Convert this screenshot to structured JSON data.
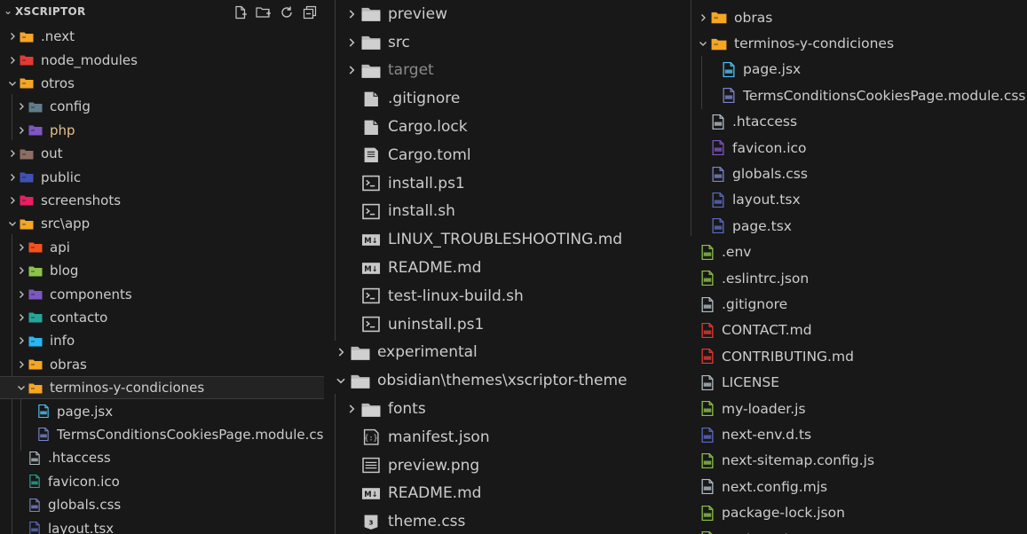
{
  "panel1": {
    "title": "XSCRIPTOR",
    "header_icons": [
      "new-file-icon",
      "new-folder-icon",
      "refresh-icon",
      "collapse-all-icon"
    ],
    "items": [
      {
        "label": ".next",
        "kind": "folder",
        "color": "#f5a623",
        "expanded": false
      },
      {
        "label": "node_modules",
        "kind": "folder",
        "color": "#e53935",
        "expanded": false
      },
      {
        "label": "otros",
        "kind": "folder",
        "color": "#f5a623",
        "expanded": true
      },
      {
        "label": "config",
        "kind": "folder",
        "color": "#607d8b",
        "expanded": false
      },
      {
        "label": "php",
        "kind": "folder",
        "color": "#7e57c2",
        "expanded": false
      },
      {
        "label": "out",
        "kind": "folder",
        "color": "#8d6e63",
        "expanded": false
      },
      {
        "label": "public",
        "kind": "folder",
        "color": "#3f51b5",
        "expanded": false
      },
      {
        "label": "screenshots",
        "kind": "folder",
        "color": "#e91e63",
        "expanded": false
      },
      {
        "label": "src\\app",
        "kind": "folder",
        "color": "#f5a623",
        "expanded": true
      },
      {
        "label": "api",
        "kind": "folder",
        "color": "#f4511e",
        "expanded": false
      },
      {
        "label": "blog",
        "kind": "folder",
        "color": "#8bc34a",
        "expanded": false
      },
      {
        "label": "components",
        "kind": "folder",
        "color": "#7e57c2",
        "expanded": false
      },
      {
        "label": "contacto",
        "kind": "folder",
        "color": "#26a69a",
        "expanded": false
      },
      {
        "label": "info",
        "kind": "folder",
        "color": "#29b6f6",
        "expanded": false
      },
      {
        "label": "obras",
        "kind": "folder",
        "color": "#f5a623",
        "expanded": false
      },
      {
        "label": "terminos-y-condiciones",
        "kind": "folder",
        "color": "#f5a623",
        "expanded": true
      },
      {
        "label": "page.jsx",
        "kind": "file",
        "color": "#4fc3f7"
      },
      {
        "label": "TermsConditionsCookiesPage.module.css",
        "kind": "file",
        "color": "#7986cb"
      },
      {
        "label": ".htaccess",
        "kind": "file",
        "color": "#b0bec5"
      },
      {
        "label": "favicon.ico",
        "kind": "file",
        "color": "#26a69a"
      },
      {
        "label": "globals.css",
        "kind": "file",
        "color": "#7986cb"
      },
      {
        "label": "layout.tsx",
        "kind": "file",
        "color": "#5c6bc0"
      }
    ]
  },
  "panel2": {
    "items": [
      {
        "label": "preview",
        "kind": "folder",
        "expanded": false
      },
      {
        "label": "src",
        "kind": "folder",
        "expanded": false
      },
      {
        "label": "target",
        "kind": "folder",
        "expanded": false
      },
      {
        "label": ".gitignore",
        "kind": "file"
      },
      {
        "label": "Cargo.lock",
        "kind": "file"
      },
      {
        "label": "Cargo.toml",
        "kind": "file"
      },
      {
        "label": "install.ps1",
        "kind": "file"
      },
      {
        "label": "install.sh",
        "kind": "file"
      },
      {
        "label": "LINUX_TROUBLESHOOTING.md",
        "kind": "file"
      },
      {
        "label": "README.md",
        "kind": "file"
      },
      {
        "label": "test-linux-build.sh",
        "kind": "file"
      },
      {
        "label": "uninstall.ps1",
        "kind": "file"
      },
      {
        "label": "experimental",
        "kind": "folder",
        "expanded": false
      },
      {
        "label": "obsidian\\themes\\xscriptor-theme",
        "kind": "folder",
        "expanded": true
      },
      {
        "label": "fonts",
        "kind": "folder",
        "expanded": false
      },
      {
        "label": "manifest.json",
        "kind": "file"
      },
      {
        "label": "preview.png",
        "kind": "file"
      },
      {
        "label": "README.md",
        "kind": "file"
      },
      {
        "label": "theme.css",
        "kind": "file"
      }
    ]
  },
  "panel3": {
    "items": [
      {
        "label": "obras",
        "kind": "folder",
        "color": "#f5a623",
        "expanded": false
      },
      {
        "label": "terminos-y-condiciones",
        "kind": "folder",
        "color": "#f5a623",
        "expanded": true
      },
      {
        "label": "page.jsx",
        "kind": "file",
        "color": "#4fc3f7"
      },
      {
        "label": "TermsConditionsCookiesPage.module.css",
        "kind": "file",
        "color": "#7986cb"
      },
      {
        "label": ".htaccess",
        "kind": "file",
        "color": "#b0bec5"
      },
      {
        "label": "favicon.ico",
        "kind": "file",
        "color": "#7e57c2"
      },
      {
        "label": "globals.css",
        "kind": "file",
        "color": "#7986cb"
      },
      {
        "label": "layout.tsx",
        "kind": "file",
        "color": "#5c6bc0"
      },
      {
        "label": "page.tsx",
        "kind": "file",
        "color": "#5c6bc0"
      },
      {
        "label": ".env",
        "kind": "file",
        "color": "#8bc34a"
      },
      {
        "label": ".eslintrc.json",
        "kind": "file",
        "color": "#8bc34a"
      },
      {
        "label": ".gitignore",
        "kind": "file",
        "color": "#b0bec5"
      },
      {
        "label": "CONTACT.md",
        "kind": "file",
        "color": "#e53935"
      },
      {
        "label": "CONTRIBUTING.md",
        "kind": "file",
        "color": "#e53935"
      },
      {
        "label": "LICENSE",
        "kind": "file",
        "color": "#b0bec5"
      },
      {
        "label": "my-loader.js",
        "kind": "file",
        "color": "#8bc34a"
      },
      {
        "label": "next-env.d.ts",
        "kind": "file",
        "color": "#5c6bc0"
      },
      {
        "label": "next-sitemap.config.js",
        "kind": "file",
        "color": "#8bc34a"
      },
      {
        "label": "next.config.mjs",
        "kind": "file",
        "color": "#b0bec5"
      },
      {
        "label": "package-lock.json",
        "kind": "file",
        "color": "#8bc34a"
      },
      {
        "label": "package.json",
        "kind": "file",
        "color": "#8bc34a"
      }
    ]
  }
}
